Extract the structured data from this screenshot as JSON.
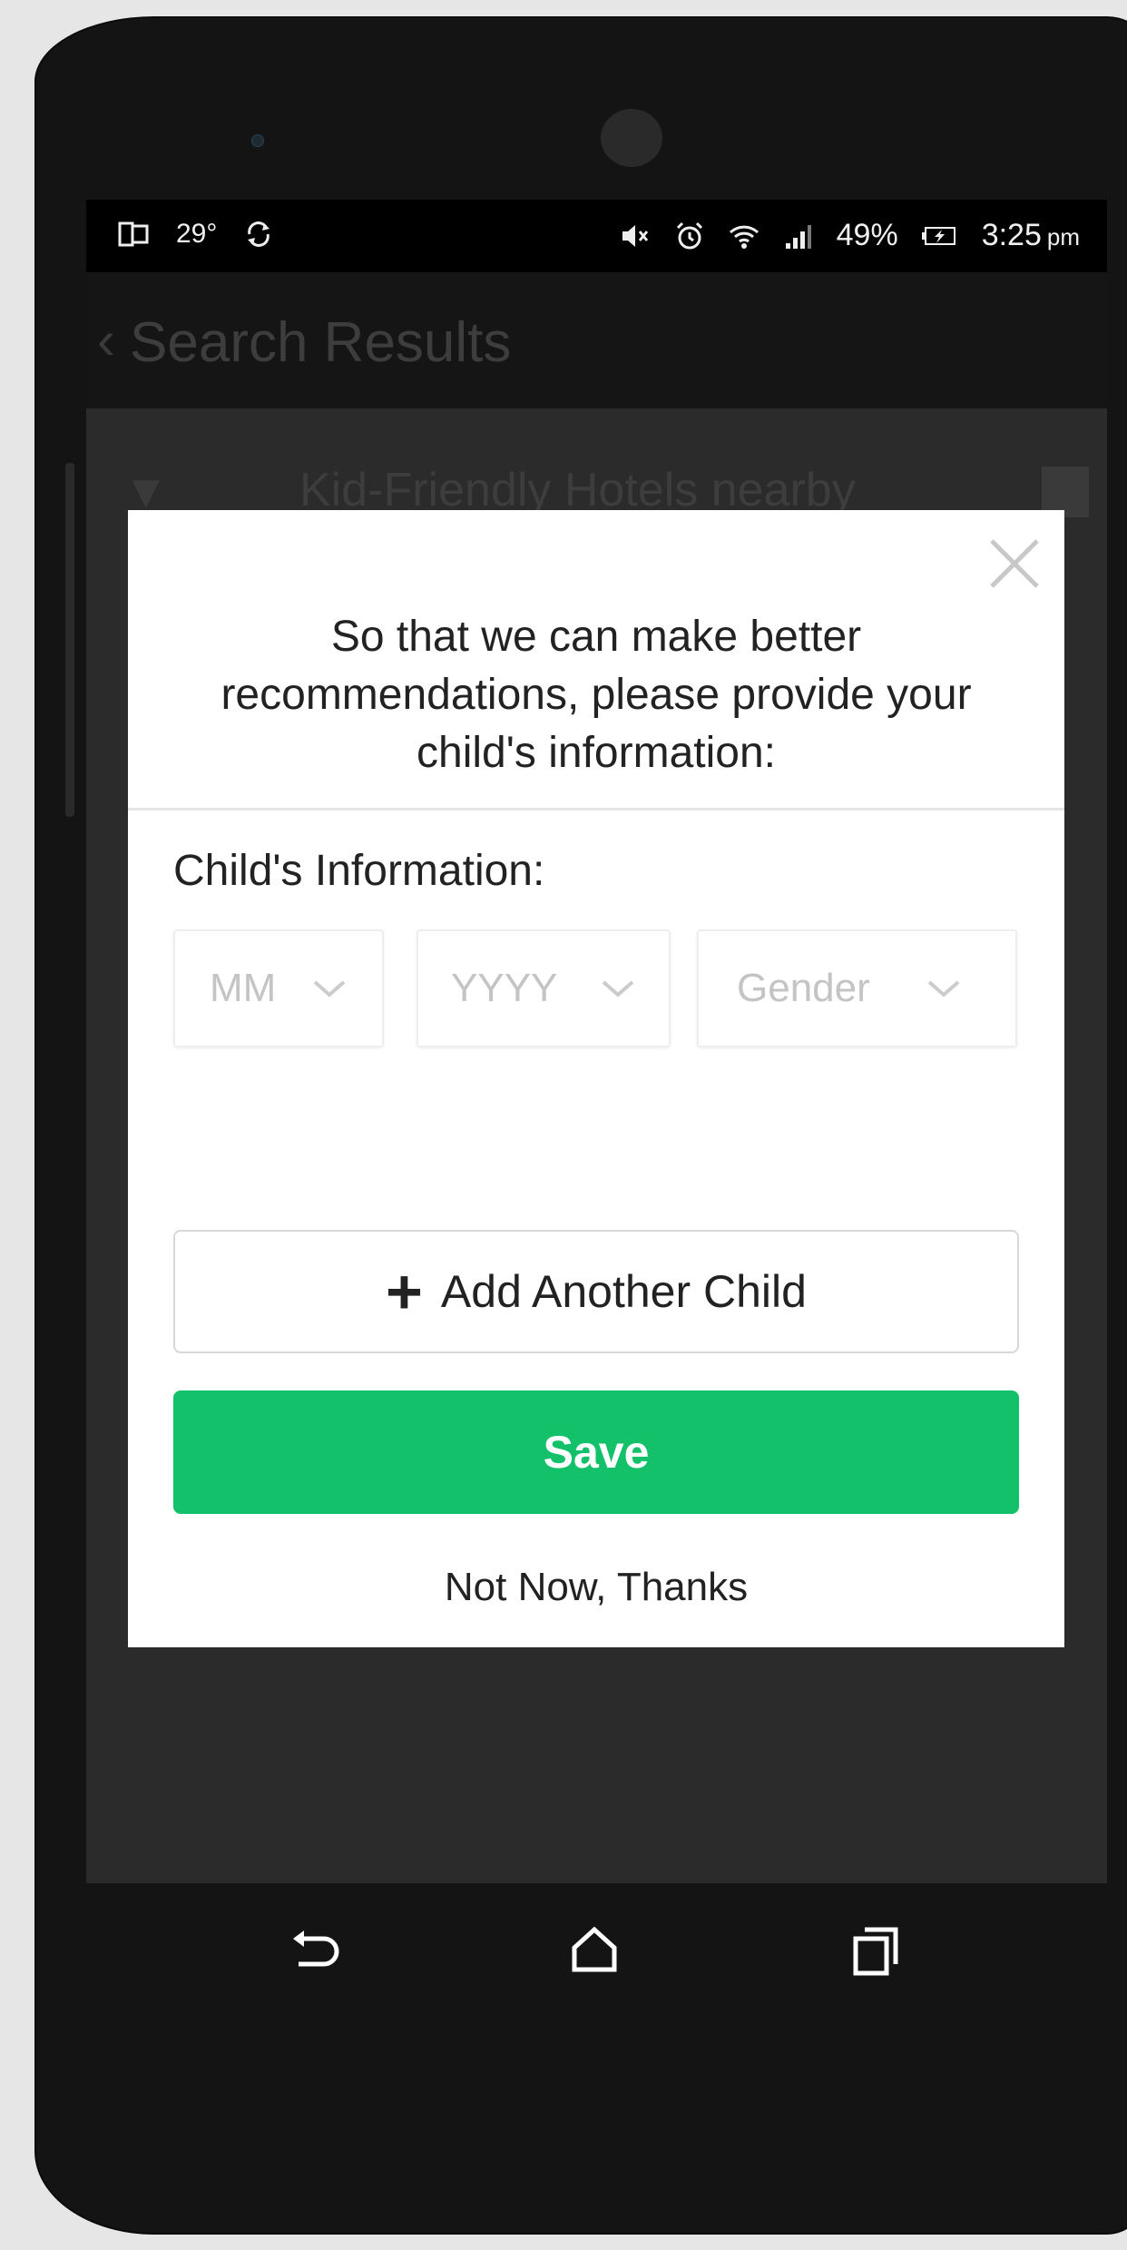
{
  "status_bar": {
    "temperature": "29°",
    "battery_percent": "49%",
    "time": "3:25",
    "time_suffix": "pm"
  },
  "app_bar": {
    "title": "Search Results"
  },
  "background_list": {
    "header_text": "Kid-Friendly Hotels nearby"
  },
  "modal": {
    "intro": "So that we can make better recommendations, please provide your child's information:",
    "section_label": "Child's Information:",
    "selects": {
      "month_placeholder": "MM",
      "year_placeholder": "YYYY",
      "gender_placeholder": "Gender"
    },
    "add_child_label": "Add Another Child",
    "save_label": "Save",
    "dismiss_label": "Not Now, Thanks"
  },
  "colors": {
    "save_green": "#13c16a",
    "overlay": "#2b2b2b"
  },
  "icons": [
    "close-icon",
    "plus-icon",
    "chevron-down-icon",
    "back-icon",
    "home-icon",
    "recents-icon",
    "wifi-icon",
    "alarm-icon",
    "mute-icon",
    "battery-icon",
    "sync-icon"
  ]
}
